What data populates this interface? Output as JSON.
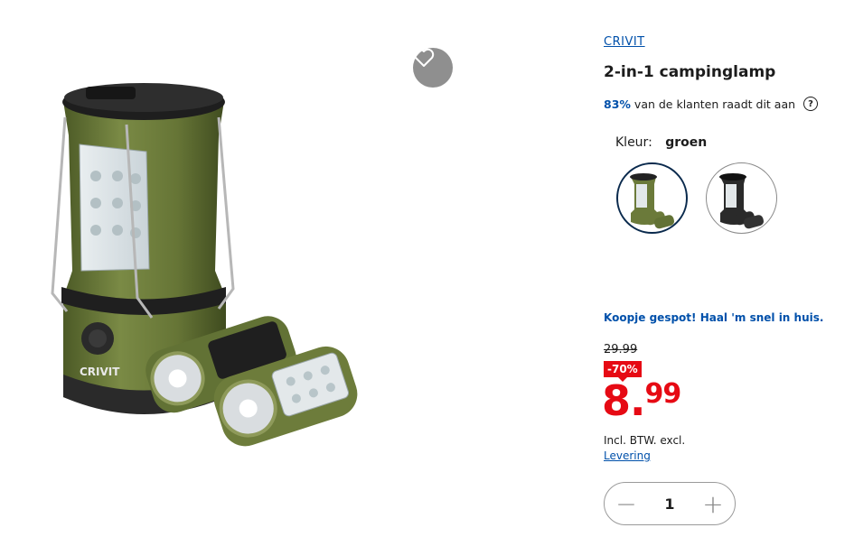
{
  "product": {
    "brand": "CRIVIT",
    "title": "2-in-1 campinglamp",
    "image_brand_label": "CRIVIT",
    "recommend": {
      "percent": "83%",
      "text": "van de klanten raadt dit aan",
      "help_icon": "?"
    }
  },
  "color": {
    "label": "Kleur:",
    "selected": "groen",
    "options": [
      {
        "name": "groen",
        "hex": "#6b7a3a"
      },
      {
        "name": "zwart",
        "hex": "#2a2a2a"
      }
    ]
  },
  "pricing": {
    "promo": "Koopje gespot! Haal 'm snel in huis.",
    "old_price": "29.99",
    "discount": "-70%",
    "price_main": "8.",
    "price_decimals": "99",
    "tax_note": "Incl. BTW. excl.",
    "delivery_link": "Levering"
  },
  "quantity": {
    "value": "1",
    "minus": "−",
    "plus": "+"
  },
  "colors": {
    "accent_blue": "#0050aa",
    "price_red": "#e60a14",
    "lamp_green": "#6b7a3a"
  }
}
